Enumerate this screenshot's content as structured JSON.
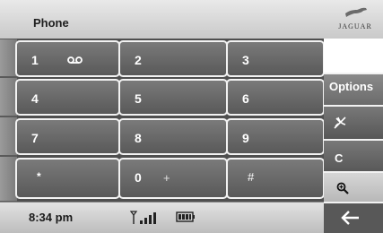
{
  "header": {
    "title": "Phone",
    "logo_text": "JAGUAR"
  },
  "keypad": {
    "keys": [
      {
        "label": "1",
        "extra": "voicemail"
      },
      {
        "label": "2"
      },
      {
        "label": "3"
      },
      {
        "label": "4"
      },
      {
        "label": "5"
      },
      {
        "label": "6"
      },
      {
        "label": "7"
      },
      {
        "label": "8"
      },
      {
        "label": "9"
      },
      {
        "label": "*"
      },
      {
        "label": "0",
        "plus": "+"
      },
      {
        "label": "#"
      }
    ]
  },
  "side": {
    "options_label": "Options",
    "clear_label": "C"
  },
  "status": {
    "time": "8:34 pm"
  },
  "icons": {
    "voicemail": "voicemail-icon",
    "mute": "microphone-mute-icon",
    "search": "magnifier-icon",
    "signal": "signal-strength-icon",
    "battery": "battery-icon",
    "back": "back-arrow-icon"
  },
  "colors": {
    "key_face": "#6a6a6a",
    "key_border": "#f2f2f2",
    "header": "#d9d9d9"
  }
}
